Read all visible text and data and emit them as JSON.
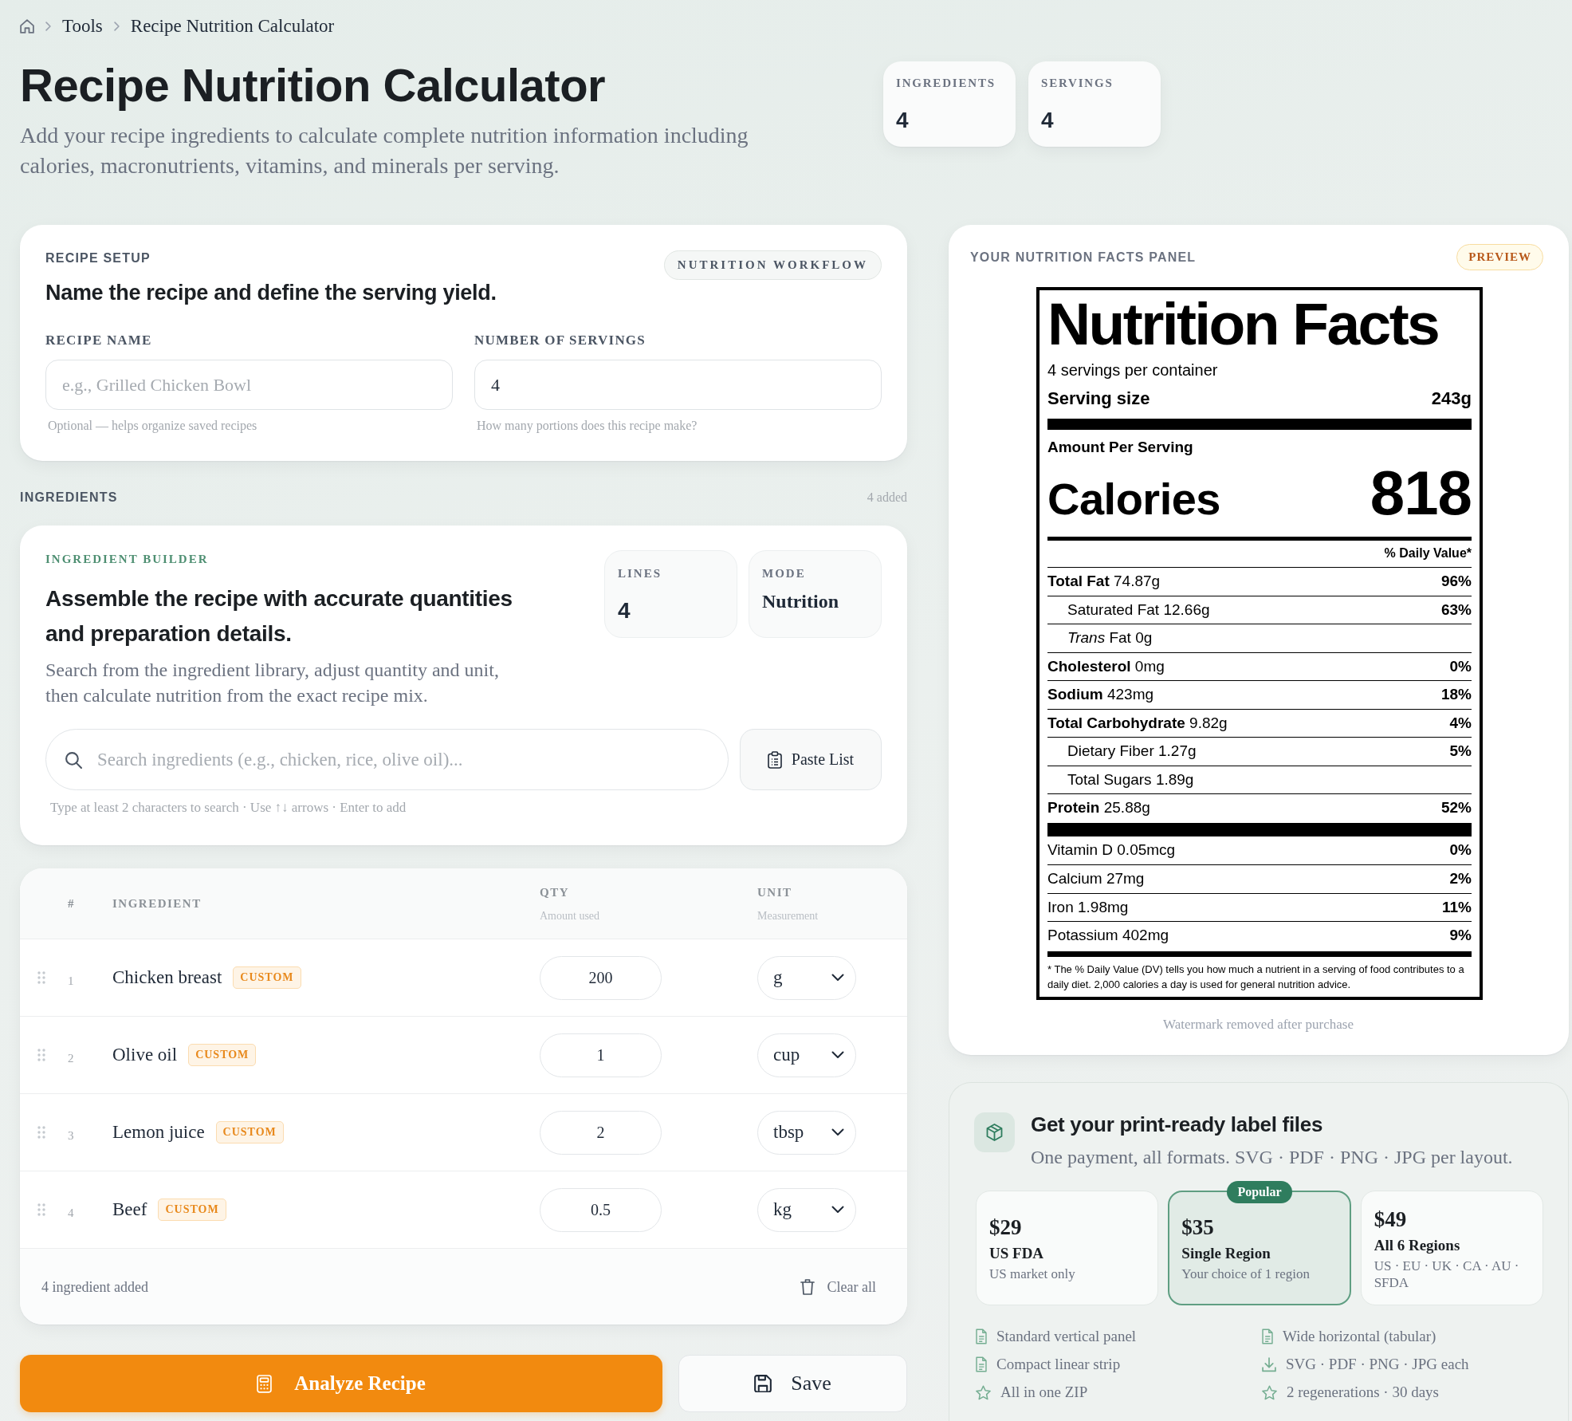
{
  "breadcrumb": {
    "items": [
      "Tools",
      "Recipe Nutrition Calculator"
    ]
  },
  "header": {
    "title": "Recipe Nutrition Calculator",
    "subtitle": "Add your recipe ingredients to calculate complete nutrition information including calories, macronutrients, vitamins, and minerals per serving.",
    "stats": [
      {
        "label": "INGREDIENTS",
        "value": "4"
      },
      {
        "label": "SERVINGS",
        "value": "4"
      }
    ]
  },
  "recipe_setup": {
    "eyebrow": "RECIPE SETUP",
    "heading": "Name the recipe and define the serving yield.",
    "badge": "NUTRITION WORKFLOW",
    "fields": [
      {
        "label": "RECIPE NAME",
        "placeholder": "e.g., Grilled Chicken Bowl",
        "hint": "Optional — helps organize saved recipes"
      },
      {
        "label": "NUMBER OF SERVINGS",
        "value": "4",
        "hint": "How many portions does this recipe make?"
      }
    ]
  },
  "ingredients_section": {
    "title": "INGREDIENTS",
    "count": "4 added"
  },
  "ingredient_builder": {
    "eyebrow": "INGREDIENT BUILDER",
    "heading": "Assemble the recipe with accurate quantities and preparation details.",
    "description": "Search from the ingredient library, adjust quantity and unit, then calculate nutrition from the exact recipe mix.",
    "stats": [
      {
        "label": "LINES",
        "value": "4",
        "kind": "number"
      },
      {
        "label": "MODE",
        "value": "Nutrition",
        "kind": "word"
      }
    ],
    "search": {
      "placeholder": "Search ingredients (e.g., chicken, rice, olive oil)..."
    },
    "paste_button": "Paste List",
    "hint": "Type at least 2 characters to search · Use ↑↓ arrows · Enter to add"
  },
  "ingredients_table": {
    "columns": [
      {
        "label": "#"
      },
      {
        "label": "INGREDIENT"
      },
      {
        "label": "QTY",
        "sublabel": "Amount used"
      },
      {
        "label": "UNIT",
        "sublabel": "Measurement"
      }
    ],
    "rows": [
      {
        "number": "1",
        "name": "Chicken breast",
        "tag": "CUSTOM",
        "qty": "200",
        "unit": "g"
      },
      {
        "number": "2",
        "name": "Olive oil",
        "tag": "CUSTOM",
        "qty": "1",
        "unit": "cup"
      },
      {
        "number": "3",
        "name": "Lemon juice",
        "tag": "CUSTOM",
        "qty": "2",
        "unit": "tbsp"
      },
      {
        "number": "4",
        "name": "Beef",
        "tag": "CUSTOM",
        "qty": "0.5",
        "unit": "kg"
      }
    ],
    "footer": {
      "count": "4 ingredient added",
      "clear_button": "Clear all"
    }
  },
  "actions": {
    "analyze_button": "Analyze Recipe",
    "save_button": "Save"
  },
  "nutrition_panel": {
    "title": "YOUR NUTRITION FACTS PANEL",
    "badge": "PREVIEW",
    "label": {
      "title": "Nutrition Facts",
      "servings": "4 servings per container",
      "serving_size_label": "Serving size",
      "serving_size": "243g",
      "amount_label": "Amount Per Serving",
      "calories_label": "Calories",
      "calories": "818",
      "dv_heading": "% Daily Value*",
      "nutrients": [
        {
          "text": "**Total Fat** 74.87g",
          "dv": "96%",
          "kind": "main"
        },
        {
          "text": "Saturated Fat 12.66g",
          "dv": "63%",
          "kind": "sub"
        },
        {
          "text": "*Trans* Fat 0g",
          "kind": "sub"
        },
        {
          "text": "**Cholesterol** 0mg",
          "dv": "0%",
          "kind": "main"
        },
        {
          "text": "**Sodium** 423mg",
          "dv": "18%",
          "kind": "main"
        },
        {
          "text": "**Total Carbohydrate** 9.82g",
          "dv": "4%",
          "kind": "main"
        },
        {
          "text": "Dietary Fiber 1.27g",
          "dv": "5%",
          "kind": "sub"
        },
        {
          "text": "Total Sugars 1.89g",
          "kind": "sub"
        },
        {
          "text": "**Protein** 25.88g",
          "dv": "52%",
          "kind": "main"
        }
      ],
      "minerals": [
        {
          "text": "Vitamin D 0.05mcg",
          "dv": "0%"
        },
        {
          "text": "Calcium 27mg",
          "dv": "2%"
        },
        {
          "text": "Iron 1.98mg",
          "dv": "11%"
        },
        {
          "text": "Potassium 402mg",
          "dv": "9%"
        }
      ],
      "footnote": "* The % Daily Value (DV) tells you how much a nutrient in a serving of food contributes to a daily diet. 2,000 calories a day is used for general nutrition advice."
    },
    "note": "Watermark removed after purchase"
  },
  "pricing": {
    "title": "Get your print-ready label files",
    "subtitle": "One payment, all formats. SVG · PDF · PNG · JPG per layout.",
    "plans": [
      {
        "price": "$29",
        "name": "US FDA",
        "description": "US market only",
        "selected": false
      },
      {
        "price": "$35",
        "name": "Single Region",
        "description": "Your choice of 1 region",
        "selected": true,
        "badge": "Popular"
      },
      {
        "price": "$49",
        "name": "All 6 Regions",
        "description": "US · EU · UK · CA · AU · SFDA",
        "selected": false
      }
    ],
    "features": [
      {
        "text": "Standard vertical panel",
        "kind": "document"
      },
      {
        "text": "Wide horizontal (tabular)",
        "kind": "document"
      },
      {
        "text": "Compact linear strip",
        "kind": "document"
      },
      {
        "text": "SVG · PDF · PNG · JPG each",
        "kind": "download"
      },
      {
        "text": "All in one ZIP",
        "kind": "star"
      },
      {
        "text": "2 regenerations · 30 days",
        "kind": "star"
      }
    ]
  }
}
